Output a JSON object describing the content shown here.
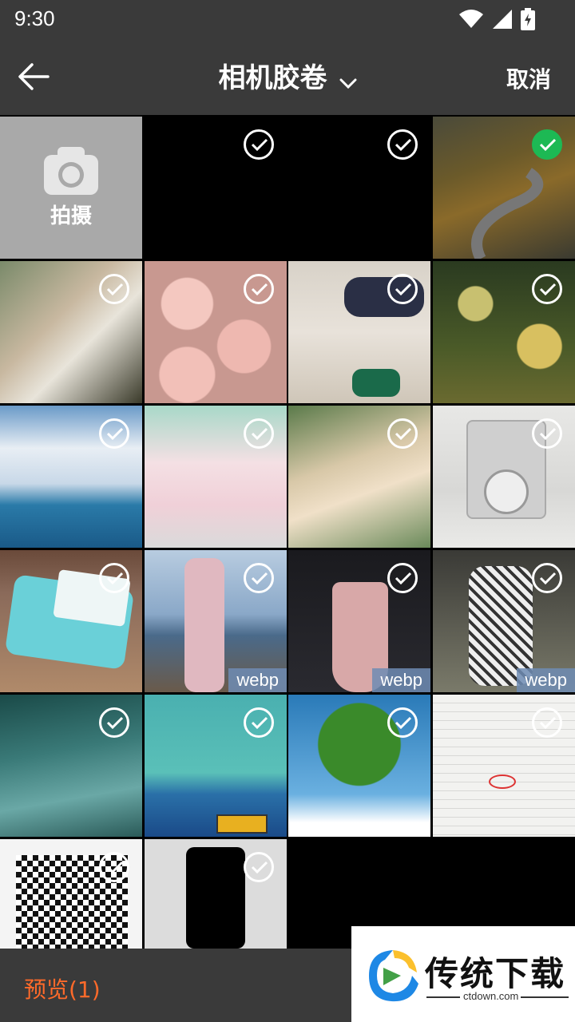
{
  "status": {
    "time": "9:30"
  },
  "header": {
    "title": "相机胶卷",
    "cancel_label": "取消"
  },
  "camera_tile": {
    "label": "拍摄"
  },
  "photos": [
    {
      "name": "photo-black-1",
      "checked": false,
      "badge": ""
    },
    {
      "name": "photo-black-2",
      "checked": false,
      "badge": ""
    },
    {
      "name": "photo-mountain-road",
      "checked": true,
      "badge": ""
    },
    {
      "name": "photo-person-with-towel",
      "checked": false,
      "badge": ""
    },
    {
      "name": "photo-pink-roses",
      "checked": false,
      "badge": ""
    },
    {
      "name": "photo-legs-on-bed",
      "checked": false,
      "badge": ""
    },
    {
      "name": "photo-jellyfish-forest",
      "checked": false,
      "badge": ""
    },
    {
      "name": "photo-sea-clouds",
      "checked": false,
      "badge": ""
    },
    {
      "name": "photo-anime-girl-heart",
      "checked": false,
      "badge": ""
    },
    {
      "name": "photo-anime-girl-flowers",
      "checked": false,
      "badge": ""
    },
    {
      "name": "photo-water-meter",
      "checked": false,
      "badge": ""
    },
    {
      "name": "photo-blue-water-meter",
      "checked": false,
      "badge": ""
    },
    {
      "name": "photo-pink-suit-pier",
      "checked": false,
      "badge": "webp"
    },
    {
      "name": "photo-pink-dress",
      "checked": false,
      "badge": "webp"
    },
    {
      "name": "photo-floral-dress",
      "checked": false,
      "badge": "webp"
    },
    {
      "name": "photo-ocean-waves",
      "checked": false,
      "badge": ""
    },
    {
      "name": "photo-bus-mountains",
      "checked": false,
      "badge": ""
    },
    {
      "name": "photo-green-tree",
      "checked": false,
      "badge": ""
    },
    {
      "name": "photo-receipt",
      "checked": false,
      "badge": ""
    },
    {
      "name": "photo-qr-code",
      "checked": false,
      "badge": ""
    },
    {
      "name": "photo-phone",
      "checked": false,
      "badge": ""
    }
  ],
  "footer": {
    "preview_label": "预览(1)"
  },
  "watermark": {
    "title": "传统下载",
    "url": "ctdown.com"
  },
  "colors": {
    "bar": "#3a3a3a",
    "accent": "#ff6a2a",
    "checked": "#1db954"
  }
}
